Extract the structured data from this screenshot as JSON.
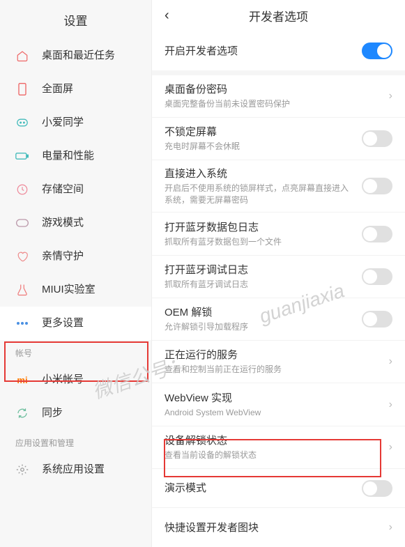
{
  "left": {
    "header": "设置",
    "sections": {
      "account_label": "帐号",
      "apps_label": "应用设置和管理"
    },
    "items": {
      "home": "桌面和最近任务",
      "fullscreen": "全面屏",
      "xiaoai": "小爱同学",
      "battery": "电量和性能",
      "storage": "存储空间",
      "game": "游戏模式",
      "family": "亲情守护",
      "lab": "MIUI实验室",
      "more": "更多设置",
      "xiaomi_account": "小米帐号",
      "sync": "同步",
      "system_apps": "系统应用设置"
    }
  },
  "right": {
    "header": "开发者选项",
    "rows": {
      "enable_dev": "开启开发者选项",
      "backup_pwd": {
        "t": "桌面备份密码",
        "s": "桌面完整备份当前未设置密码保护"
      },
      "no_lock": {
        "t": "不锁定屏幕",
        "s": "充电时屏幕不会休眠"
      },
      "direct_sys": {
        "t": "直接进入系统",
        "s": "开启后不使用系统的锁屏样式，点亮屏幕直接进入系统，需要无屏幕密码"
      },
      "bt_pkg_log": {
        "t": "打开蓝牙数据包日志",
        "s": "抓取所有蓝牙数据包到一个文件"
      },
      "bt_dbg_log": {
        "t": "打开蓝牙调试日志",
        "s": "抓取所有蓝牙调试日志"
      },
      "oem_unlock": {
        "t": "OEM 解锁",
        "s": "允许解锁引导加载程序"
      },
      "running_svc": {
        "t": "正在运行的服务",
        "s": "查看和控制当前正在运行的服务"
      },
      "webview": {
        "t": "WebView 实现",
        "s": "Android System WebView"
      },
      "unlock_status": {
        "t": "设备解锁状态",
        "s": "查看当前设备的解锁状态"
      },
      "demo": "演示模式",
      "quick_tiles": "快捷设置开发者图块"
    }
  },
  "watermark": {
    "a": "微信公号：",
    "b": "guanjiaxia"
  }
}
